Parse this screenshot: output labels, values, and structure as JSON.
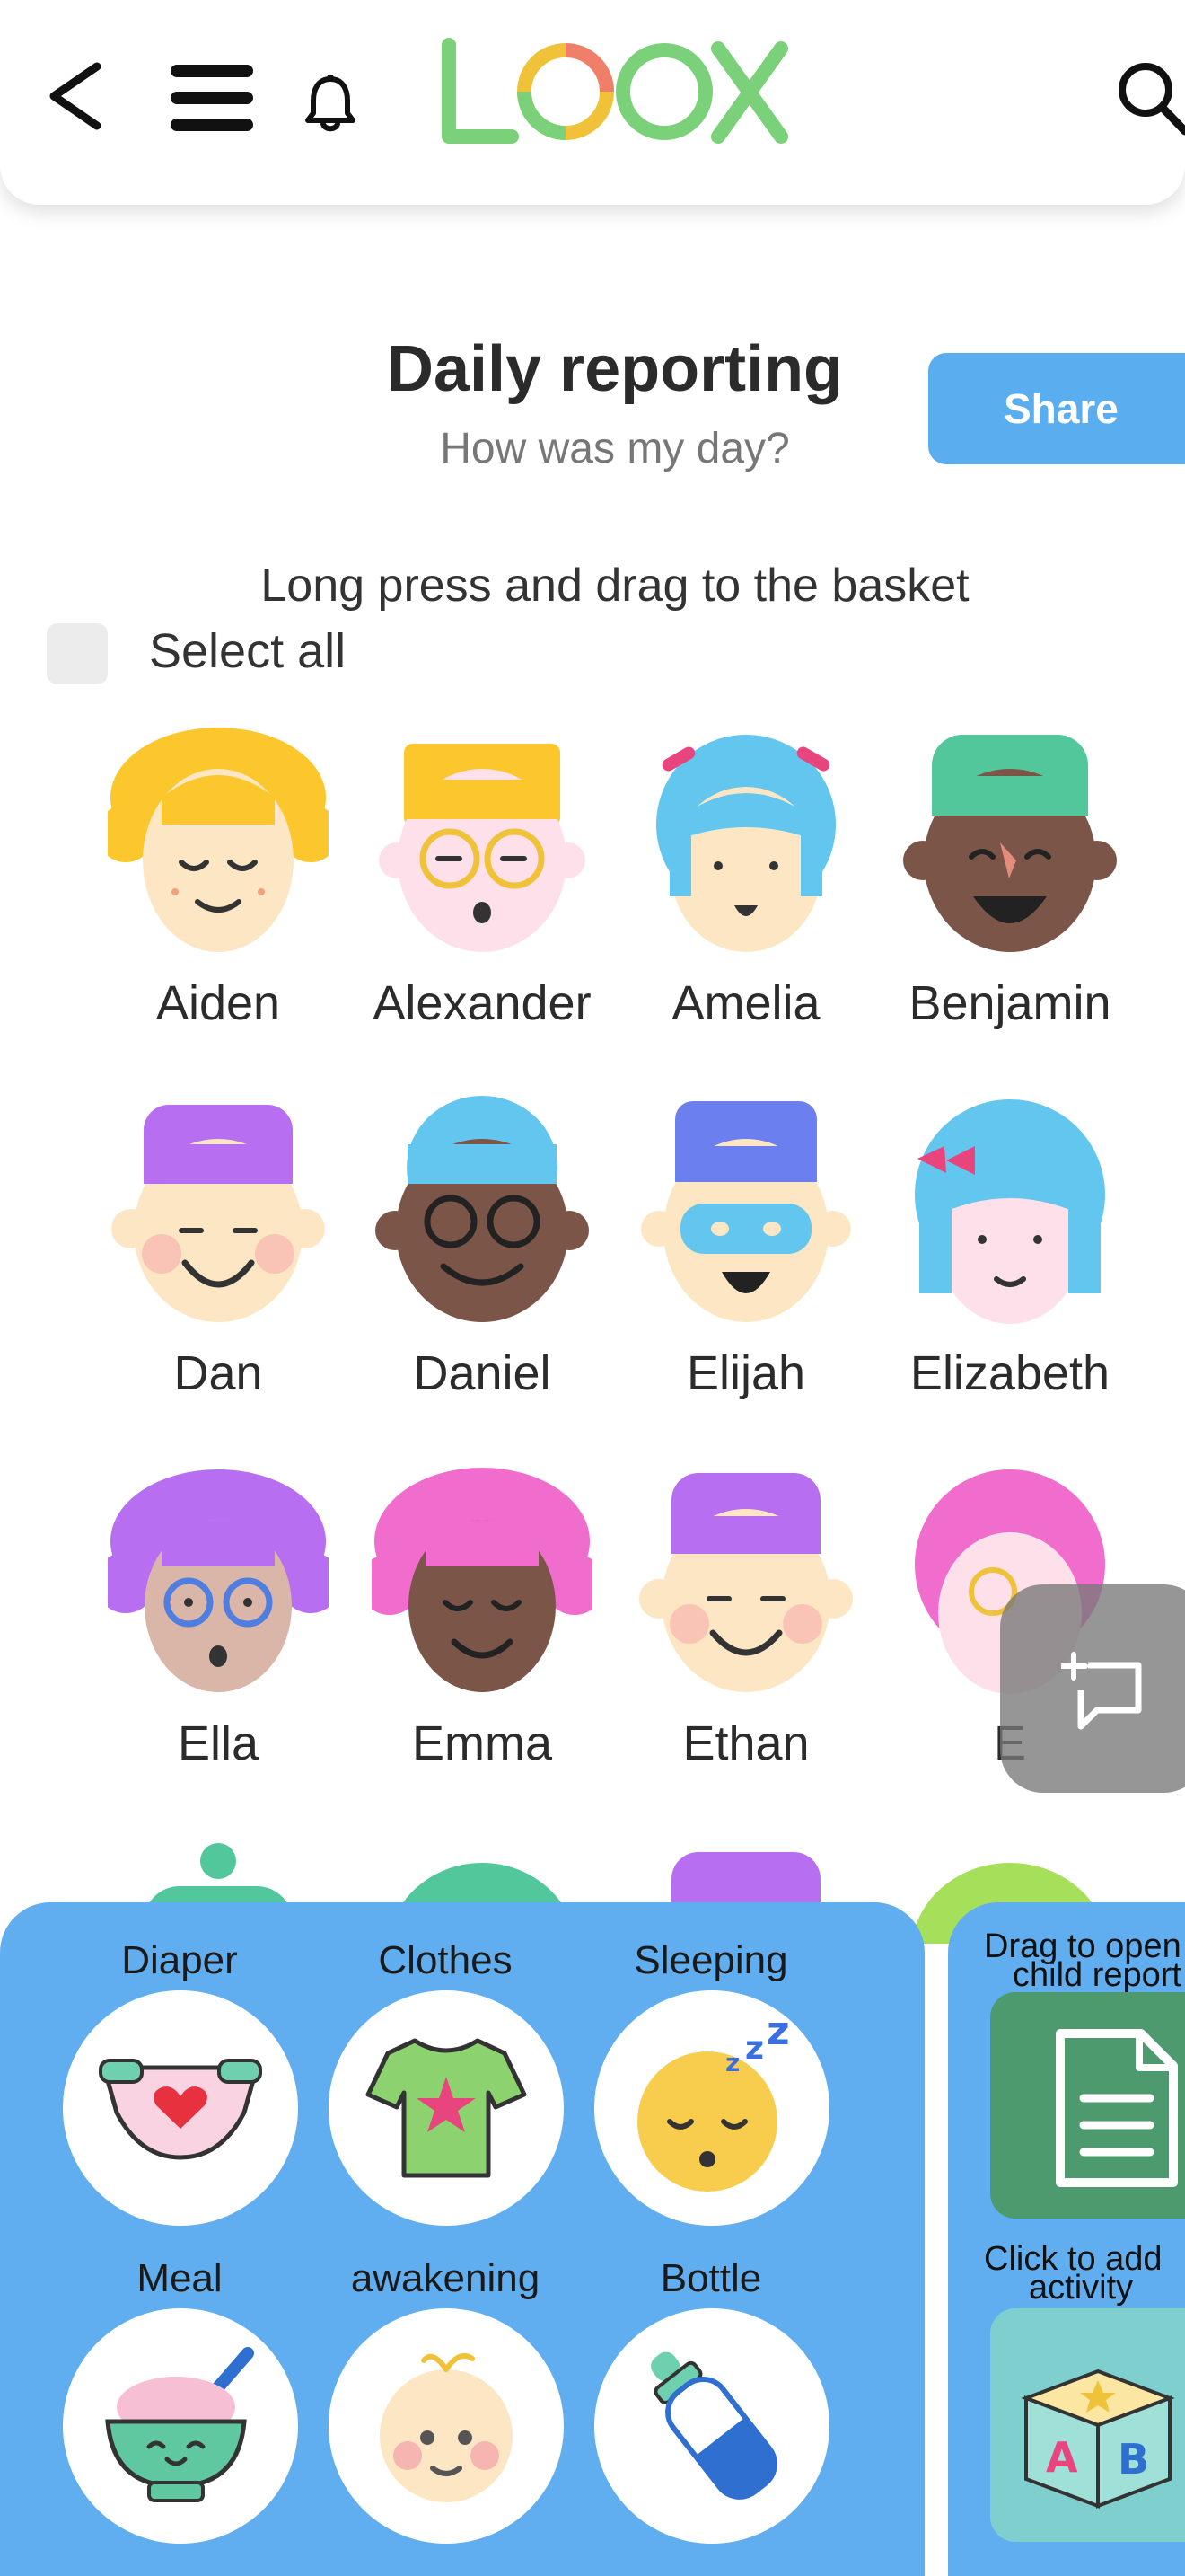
{
  "header": {
    "logo_text": "LOOX",
    "icons": [
      "back-icon",
      "menu-icon",
      "bell-icon",
      "search-icon"
    ]
  },
  "page": {
    "title": "Daily reporting",
    "subtitle": "How was my day?",
    "share_label": "Share",
    "instruction": "Long press and drag to the basket",
    "select_all_label": "Select all"
  },
  "children": [
    {
      "name": "Aiden"
    },
    {
      "name": "Alexander"
    },
    {
      "name": "Amelia"
    },
    {
      "name": "Benjamin"
    },
    {
      "name": "Dan"
    },
    {
      "name": "Daniel"
    },
    {
      "name": "Elijah"
    },
    {
      "name": "Elizabeth"
    },
    {
      "name": "Ella"
    },
    {
      "name": "Emma"
    },
    {
      "name": "Ethan"
    },
    {
      "name": "E"
    }
  ],
  "activities": [
    {
      "label": "Diaper",
      "icon": "diaper-icon"
    },
    {
      "label": "Clothes",
      "icon": "tshirt-icon"
    },
    {
      "label": "Sleeping",
      "icon": "sleeping-face-icon"
    },
    {
      "label": "Meal",
      "icon": "meal-bowl-icon"
    },
    {
      "label": "awakening",
      "icon": "baby-face-icon"
    },
    {
      "label": "Bottle",
      "icon": "baby-bottle-icon"
    }
  ],
  "side_panel": {
    "report_label_line1": "Drag to open",
    "report_label_line2": "child report",
    "add_label_line1": "Click to add",
    "add_label_line2": "activity"
  },
  "colors": {
    "accent_blue": "#5aaeef",
    "panel_blue": "#60aef0",
    "logo_green": "#7bd07a",
    "report_tile": "#4e9a6f",
    "add_tile": "#7fcfcf"
  }
}
